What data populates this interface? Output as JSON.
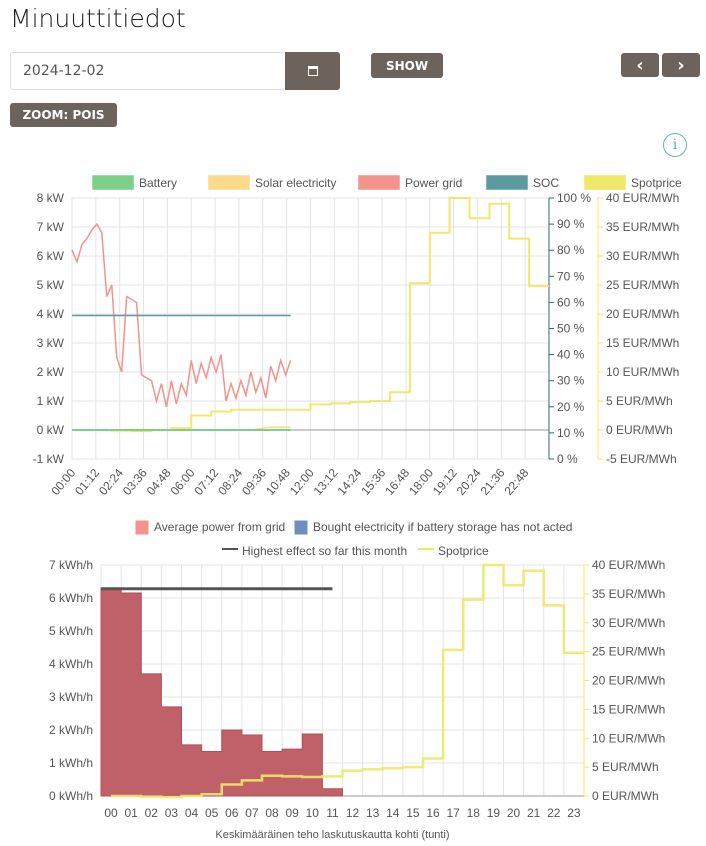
{
  "title": "Minuuttitiedot",
  "date_value": "2024-12-02",
  "buttons": {
    "show": "SHOW",
    "zoom": "ZOOM: POIS",
    "prev": "‹",
    "next": "›"
  },
  "icons": {
    "calendar": "calendar-icon",
    "info": "info-icon"
  },
  "info_glyph": "i",
  "chart_data": [
    {
      "type": "line",
      "legend": [
        {
          "name": "Battery",
          "color": "#7dd08a"
        },
        {
          "name": "Solar electricity",
          "color": "#fdd98a"
        },
        {
          "name": "Power grid",
          "color": "#f4928c"
        },
        {
          "name": "SOC",
          "color": "#5b9ba0"
        },
        {
          "name": "Spotprice",
          "color": "#f0e868"
        }
      ],
      "y_left": {
        "ticks": [
          "8 kW",
          "7 kW",
          "6 kW",
          "5 kW",
          "4 kW",
          "3 kW",
          "2 kW",
          "1 kW",
          "0 kW",
          "-1 kW"
        ],
        "range": [
          -1,
          8
        ]
      },
      "y_soc": {
        "ticks": [
          "100 %",
          "90 %",
          "80 %",
          "70 %",
          "60 %",
          "50 %",
          "40 %",
          "30 %",
          "20 %",
          "10 %",
          "0 %"
        ],
        "range": [
          0,
          100
        ]
      },
      "y_price": {
        "ticks": [
          "40 EUR/MWh",
          "35 EUR/MWh",
          "30 EUR/MWh",
          "25 EUR/MWh",
          "20 EUR/MWh",
          "15 EUR/MWh",
          "10 EUR/MWh",
          "5 EUR/MWh",
          "0 EUR/MWh",
          "-5 EUR/MWh"
        ],
        "range": [
          -5,
          40
        ]
      },
      "x_ticks": [
        "00:00",
        "01:12",
        "02:24",
        "03:36",
        "04:48",
        "06:00",
        "07:12",
        "08:24",
        "09:36",
        "10:48",
        "12:00",
        "13:12",
        "14:24",
        "15:36",
        "16:48",
        "18:00",
        "19:12",
        "20:24",
        "21:36",
        "22:48"
      ],
      "power_grid": [
        6.2,
        5.8,
        6.4,
        6.6,
        6.9,
        7.1,
        6.8,
        4.6,
        5.0,
        2.5,
        2.0,
        4.6,
        4.5,
        4.4,
        1.9,
        1.8,
        1.7,
        1.0,
        1.6,
        0.8,
        1.7,
        0.9,
        1.6,
        1.2,
        2.4,
        1.6,
        2.3,
        1.8,
        2.5,
        2.0,
        2.6,
        1.0,
        1.6,
        1.1,
        1.7,
        1.2,
        2.0,
        1.3,
        1.8,
        1.1,
        2.2,
        1.7,
        2.4,
        1.9,
        2.4
      ],
      "power_grid_interval_min": 15,
      "soc": [
        55,
        55,
        55,
        55,
        55,
        55,
        55,
        55,
        55,
        55,
        55,
        55
      ],
      "battery": [
        0,
        0,
        0,
        0,
        0,
        0,
        0,
        0,
        0,
        0,
        0,
        0
      ],
      "solar": [
        0,
        0,
        0,
        0,
        0,
        0,
        0,
        0,
        0,
        0,
        0.1,
        0.1
      ],
      "spotprice": [
        0,
        0,
        -0.1,
        -0.2,
        0,
        0.3,
        2.5,
        3.2,
        3.5,
        3.5,
        3.5,
        3.5,
        4.4,
        4.6,
        4.8,
        5.0,
        6.5,
        25.3,
        34,
        40,
        36.5,
        39,
        33,
        24.8
      ]
    },
    {
      "type": "bar",
      "legend": [
        {
          "name": "Average power from grid",
          "color": "#f4928c"
        },
        {
          "name": "Bought electricity if battery storage has not acted",
          "color": "#6f8fc0"
        },
        {
          "name": "Highest effect so far this month",
          "color": "#555555"
        },
        {
          "name": "Spotprice",
          "color": "#f0e868"
        }
      ],
      "categories": [
        "00",
        "01",
        "02",
        "03",
        "04",
        "05",
        "06",
        "07",
        "08",
        "09",
        "10",
        "11",
        "12",
        "13",
        "14",
        "15",
        "16",
        "17",
        "18",
        "19",
        "20",
        "21",
        "22",
        "23"
      ],
      "y_left": {
        "ticks": [
          "7 kWh/h",
          "6 kWh/h",
          "5 kWh/h",
          "4 kWh/h",
          "3 kWh/h",
          "2 kWh/h",
          "1 kWh/h",
          "0 kWh/h"
        ],
        "range": [
          0,
          7
        ]
      },
      "y_right": {
        "ticks": [
          "40 EUR/MWh",
          "35 EUR/MWh",
          "30 EUR/MWh",
          "25 EUR/MWh",
          "20 EUR/MWh",
          "15 EUR/MWh",
          "10 EUR/MWh",
          "5 EUR/MWh",
          "0 EUR/MWh"
        ],
        "range": [
          0,
          40
        ]
      },
      "bars": [
        6.3,
        6.15,
        3.7,
        2.7,
        1.55,
        1.35,
        2.0,
        1.85,
        1.35,
        1.42,
        1.88,
        0.22
      ],
      "bar_color": "#c0616a",
      "highest_effect": 6.28,
      "spotprice": [
        0,
        0,
        -0.1,
        -0.2,
        0,
        0.3,
        2,
        2.7,
        3.5,
        3.4,
        3.3,
        3.4,
        4.4,
        4.6,
        4.8,
        5.0,
        6.5,
        25.3,
        34,
        40,
        36.5,
        39,
        33,
        24.8
      ],
      "xlabel": "Keskimääräinen teho laskutuskautta kohti (tunti)"
    }
  ]
}
